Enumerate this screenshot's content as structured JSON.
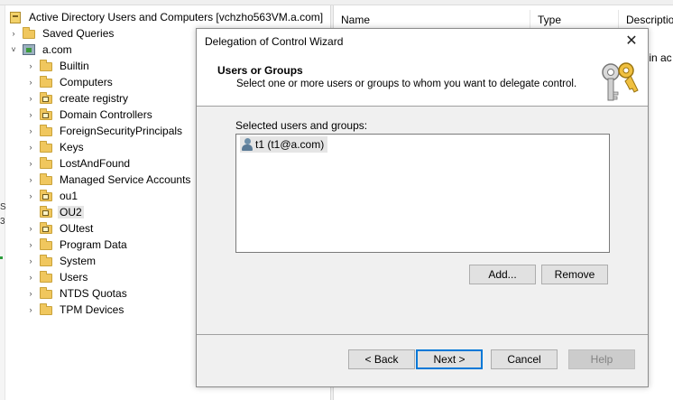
{
  "console": {
    "root_label": "Active Directory Users and Computers [vchzho563VM.a.com]",
    "tree": [
      {
        "label": "Saved Queries",
        "expander": ">",
        "icon": "folder-icon"
      },
      {
        "label": "a.com",
        "expander": "v",
        "icon": "domain-icon"
      },
      {
        "label": "Builtin",
        "expander": ">",
        "icon": "folder-icon"
      },
      {
        "label": "Computers",
        "expander": ">",
        "icon": "folder-icon"
      },
      {
        "label": "create registry",
        "expander": ">",
        "icon": "ou-folder-icon"
      },
      {
        "label": "Domain Controllers",
        "expander": ">",
        "icon": "ou-folder-icon"
      },
      {
        "label": "ForeignSecurityPrincipals",
        "expander": ">",
        "icon": "folder-icon"
      },
      {
        "label": "Keys",
        "expander": ">",
        "icon": "folder-icon"
      },
      {
        "label": "LostAndFound",
        "expander": ">",
        "icon": "folder-icon"
      },
      {
        "label": "Managed Service Accounts",
        "expander": ">",
        "icon": "folder-icon"
      },
      {
        "label": "ou1",
        "expander": ">",
        "icon": "ou-folder-icon"
      },
      {
        "label": "OU2",
        "expander": "",
        "icon": "ou-folder-icon",
        "selected": true
      },
      {
        "label": "OUtest",
        "expander": ">",
        "icon": "ou-folder-icon"
      },
      {
        "label": "Program Data",
        "expander": ">",
        "icon": "folder-icon"
      },
      {
        "label": "System",
        "expander": ">",
        "icon": "folder-icon"
      },
      {
        "label": "Users",
        "expander": ">",
        "icon": "folder-icon"
      },
      {
        "label": "NTDS Quotas",
        "expander": ">",
        "icon": "folder-icon"
      },
      {
        "label": "TPM Devices",
        "expander": ">",
        "icon": "folder-icon"
      }
    ],
    "columns": [
      "Name",
      "Type",
      "Descriptio"
    ],
    "partial_text": "t-in ac",
    "edge_marks": [
      "S",
      "3"
    ]
  },
  "dialog": {
    "title": "Delegation of Control Wizard",
    "close_glyph": "✕",
    "header_title": "Users or Groups",
    "header_subtitle": "Select one or more users or groups to whom you want to delegate control.",
    "selected_label": "Selected users and groups:",
    "selected_items": [
      {
        "text": "t1 (t1@a.com)"
      }
    ],
    "buttons": {
      "add": "Add...",
      "remove": "Remove",
      "back": "< Back",
      "next": "Next >",
      "cancel": "Cancel",
      "help": "Help"
    }
  },
  "colors": {
    "accent": "#0078d7",
    "dialog_bg": "#f0f0f0",
    "selection_bg": "#e5e5e5",
    "folder": "#f0c75e"
  }
}
